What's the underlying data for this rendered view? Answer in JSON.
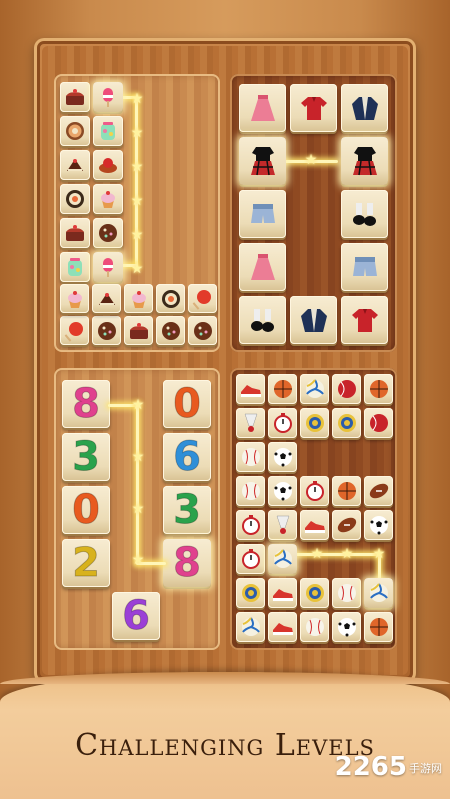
{
  "caption": "Challenging Levels",
  "watermark": {
    "text": "2265",
    "suffix": "手游网"
  },
  "numbers_panel": {
    "left_column": [
      "8",
      "3",
      "0",
      "2"
    ],
    "right_column": [
      "0",
      "6",
      "3",
      "8"
    ],
    "bottom": "6"
  },
  "colors": {
    "accent_glow": "#ffe66d",
    "tile_face": "#f3e6c6",
    "wood": "#c98a4c"
  }
}
